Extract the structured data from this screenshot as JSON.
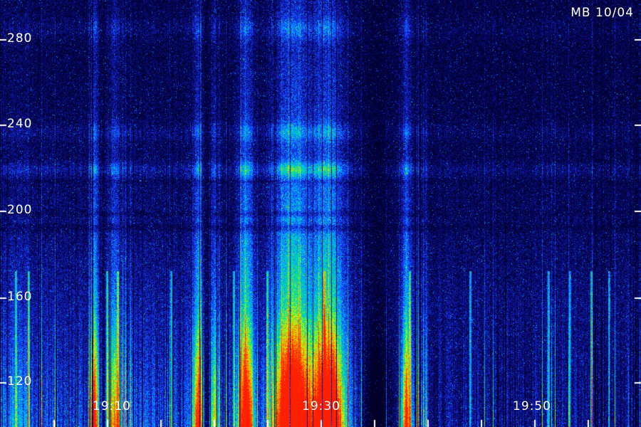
{
  "chart_data": {
    "type": "heatmap",
    "title": "MB 10/04",
    "ylabel": "",
    "xlabel": "",
    "y_ticks": [
      {
        "value": 280,
        "label": "280"
      },
      {
        "value": 240,
        "label": "240"
      },
      {
        "value": 200,
        "label": "200"
      },
      {
        "value": 160,
        "label": "160"
      },
      {
        "value": 120,
        "label": "120"
      }
    ],
    "x_ticks": [
      {
        "label": "19:10"
      },
      {
        "label": "19:30"
      },
      {
        "label": "19:50"
      }
    ],
    "ylim": [
      108,
      298
    ],
    "colormap": [
      "#000028",
      "#0a0a7a",
      "#1a3cff",
      "#00b4ff",
      "#00e08a",
      "#c8ff00",
      "#ff9000",
      "#ff2000"
    ],
    "grid": false
  }
}
